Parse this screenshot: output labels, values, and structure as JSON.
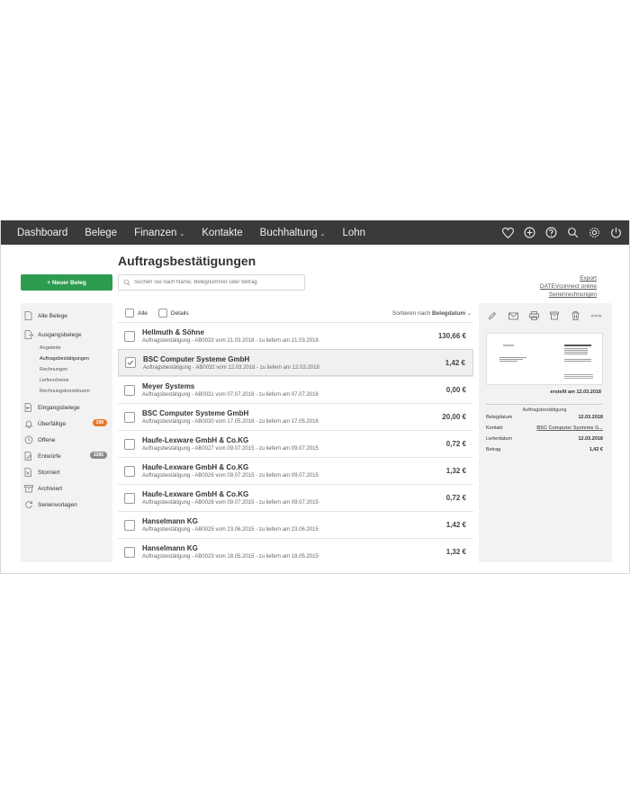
{
  "nav": {
    "items": [
      {
        "label": "Dashboard",
        "caret": ""
      },
      {
        "label": "Belege",
        "caret": ""
      },
      {
        "label": "Finanzen",
        "caret": "⌄"
      },
      {
        "label": "Kontakte",
        "caret": ""
      },
      {
        "label": "Buchhaltung",
        "caret": "⌄"
      },
      {
        "label": "Lohn",
        "caret": ""
      }
    ],
    "icons": [
      "heart-icon",
      "plus-circle-icon",
      "help-icon",
      "search-icon",
      "gear-icon",
      "power-icon"
    ]
  },
  "page_title": "Auftragsbestätigungen",
  "new_button": "+ Neuer Beleg",
  "search": {
    "placeholder": "Suchen Sie nach Name, Belegnummer oder Betrag"
  },
  "links": {
    "export": "Export",
    "datev": "DATEVconnect online",
    "serien": "Serienrechnungen"
  },
  "sidebar": {
    "alle_belege": "Alle Belege",
    "ausgangsbelege": "Ausgangsbelege",
    "sub": [
      "Angebote",
      "Auftragsbestätigungen",
      "Rechnungen",
      "Lieferscheine",
      "Rechnungskorrekturen"
    ],
    "eingangsbelege": "Eingangsbelege",
    "ueberfaellige": "Überfällige",
    "ueberfaellige_count": "298",
    "offene": "Offene",
    "entwuerfe": "Entwürfe",
    "entwuerfe_count": "2285",
    "storniert": "Storniert",
    "archiviert": "Archiviert",
    "serienvorlagen": "Serienvorlagen",
    "colors": {
      "overdue_badge": "#e8762c",
      "draft_badge": "#8a8a8a"
    }
  },
  "list_header": {
    "alle": "Alle",
    "details": "Details",
    "sort_prefix": "Sortieren nach",
    "sort_field": "Belegdatum",
    "sort_caret": "⌄"
  },
  "rows": [
    {
      "name": "Hellmuth & Söhne",
      "sub": "Auftragsbestätigung - AB0033 vom 21.03.2018 - zu liefern am 21.03.2018",
      "amount": "130,66 €",
      "selected": false
    },
    {
      "name": "BSC Computer Systeme GmbH",
      "sub": "Auftragsbestätigung - AB0032 vom 12.03.2018 - zu liefern am 12.03.2018",
      "amount": "1,42 €",
      "selected": true
    },
    {
      "name": "Meyer Systems",
      "sub": "Auftragsbestätigung - AB0031 vom 07.07.2016 - zu liefern am 07.07.2016",
      "amount": "0,00 €",
      "selected": false
    },
    {
      "name": "BSC Computer Systeme GmbH",
      "sub": "Auftragsbestätigung - AB0030 vom 17.05.2016 - zu liefern am 17.05.2016",
      "amount": "20,00 €",
      "selected": false
    },
    {
      "name": "Haufe-Lexware GmbH & Co.KG",
      "sub": "Auftragsbestätigung - AB0027 vom 09.07.2015 - zu liefern am 09.07.2015",
      "amount": "0,72 €",
      "selected": false
    },
    {
      "name": "Haufe-Lexware GmbH & Co.KG",
      "sub": "Auftragsbestätigung - AB0026 vom 09.07.2015 - zu liefern am 09.07.2015",
      "amount": "1,32 €",
      "selected": false
    },
    {
      "name": "Haufe-Lexware GmbH & Co.KG",
      "sub": "Auftragsbestätigung - AB0028 vom 09.07.2015 - zu liefern am 09.07.2015",
      "amount": "0,72 €",
      "selected": false
    },
    {
      "name": "Hanselmann KG",
      "sub": "Auftragsbestätigung - AB0025 vom 23.06.2015 - zu liefern am 23.06.2015",
      "amount": "1,42 €",
      "selected": false
    },
    {
      "name": "Hanselmann KG",
      "sub": "Auftragsbestätigung - AB0023 vom 18.05.2015 - zu liefern am 18.05.2015",
      "amount": "1,32 €",
      "selected": false
    }
  ],
  "detail": {
    "tools": [
      "edit-icon",
      "mail-icon",
      "print-icon",
      "archive-icon",
      "trash-icon",
      "more-icon"
    ],
    "created": "erstellt am 12.03.2018",
    "doc_type": "Auftragsbestätigung",
    "fields": [
      {
        "label": "Belegdatum",
        "value": "12.03.2018",
        "link": false
      },
      {
        "label": "Kontakt",
        "value": "BSC Computer Systeme G...",
        "link": true
      },
      {
        "label": "Lieferdatum",
        "value": "12.03.2018",
        "link": false
      },
      {
        "label": "Betrag",
        "value": "1,42 €",
        "link": false
      }
    ]
  },
  "colors": {
    "nav_bg": "#3a3a3a",
    "primary_green": "#2e9c4f",
    "panel_bg": "#f2f2f2"
  }
}
